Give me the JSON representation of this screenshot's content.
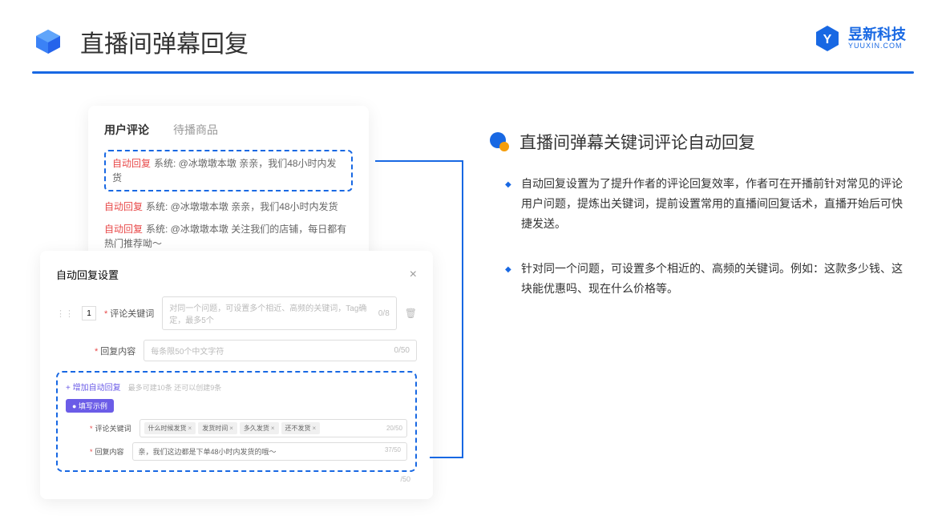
{
  "header": {
    "title": "直播间弹幕回复"
  },
  "brand": {
    "name": "昱新科技",
    "url": "YUUXIN.COM"
  },
  "comments_card": {
    "tab_active": "用户评论",
    "tab_inactive": "待播商品",
    "reply_tag": "自动回复",
    "rows": [
      "系统: @冰墩墩本墩 亲亲，我们48小时内发货",
      "系统: @冰墩墩本墩 亲亲，我们48小时内发货",
      "系统: @冰墩墩本墩 关注我们的店铺，每日都有热门推荐呦～"
    ]
  },
  "settings_card": {
    "title": "自动回复设置",
    "row_num": "1",
    "keyword_label": "评论关键词",
    "keyword_placeholder": "对同一个问题，可设置多个相近、高频的关键词，Tag确定，最多5个",
    "keyword_count": "0/8",
    "content_label": "回复内容",
    "content_placeholder": "每条限50个中文字符",
    "content_count": "0/50",
    "add_link": "+ 增加自动回复",
    "add_hint": "最多可建10条 还可以创建9条",
    "example_badge": "● 填写示例",
    "ex_keyword_label": "评论关键词",
    "ex_tags": [
      "什么时候发货",
      "发货时间",
      "多久发货",
      "还不发货"
    ],
    "ex_keyword_count": "20/50",
    "ex_content_label": "回复内容",
    "ex_content_text": "亲，我们这边都是下单48小时内发货的哦～",
    "ex_content_count": "37/50",
    "outer_count": "/50"
  },
  "right": {
    "section_title": "直播间弹幕关键词评论自动回复",
    "bullets": [
      "自动回复设置为了提升作者的评论回复效率，作者可在开播前针对常见的评论用户问题，提炼出关键词，提前设置常用的直播间回复话术，直播开始后可快捷发送。",
      "针对同一个问题，可设置多个相近的、高频的关键词。例如：这款多少钱、这块能优惠吗、现在什么价格等。"
    ]
  }
}
